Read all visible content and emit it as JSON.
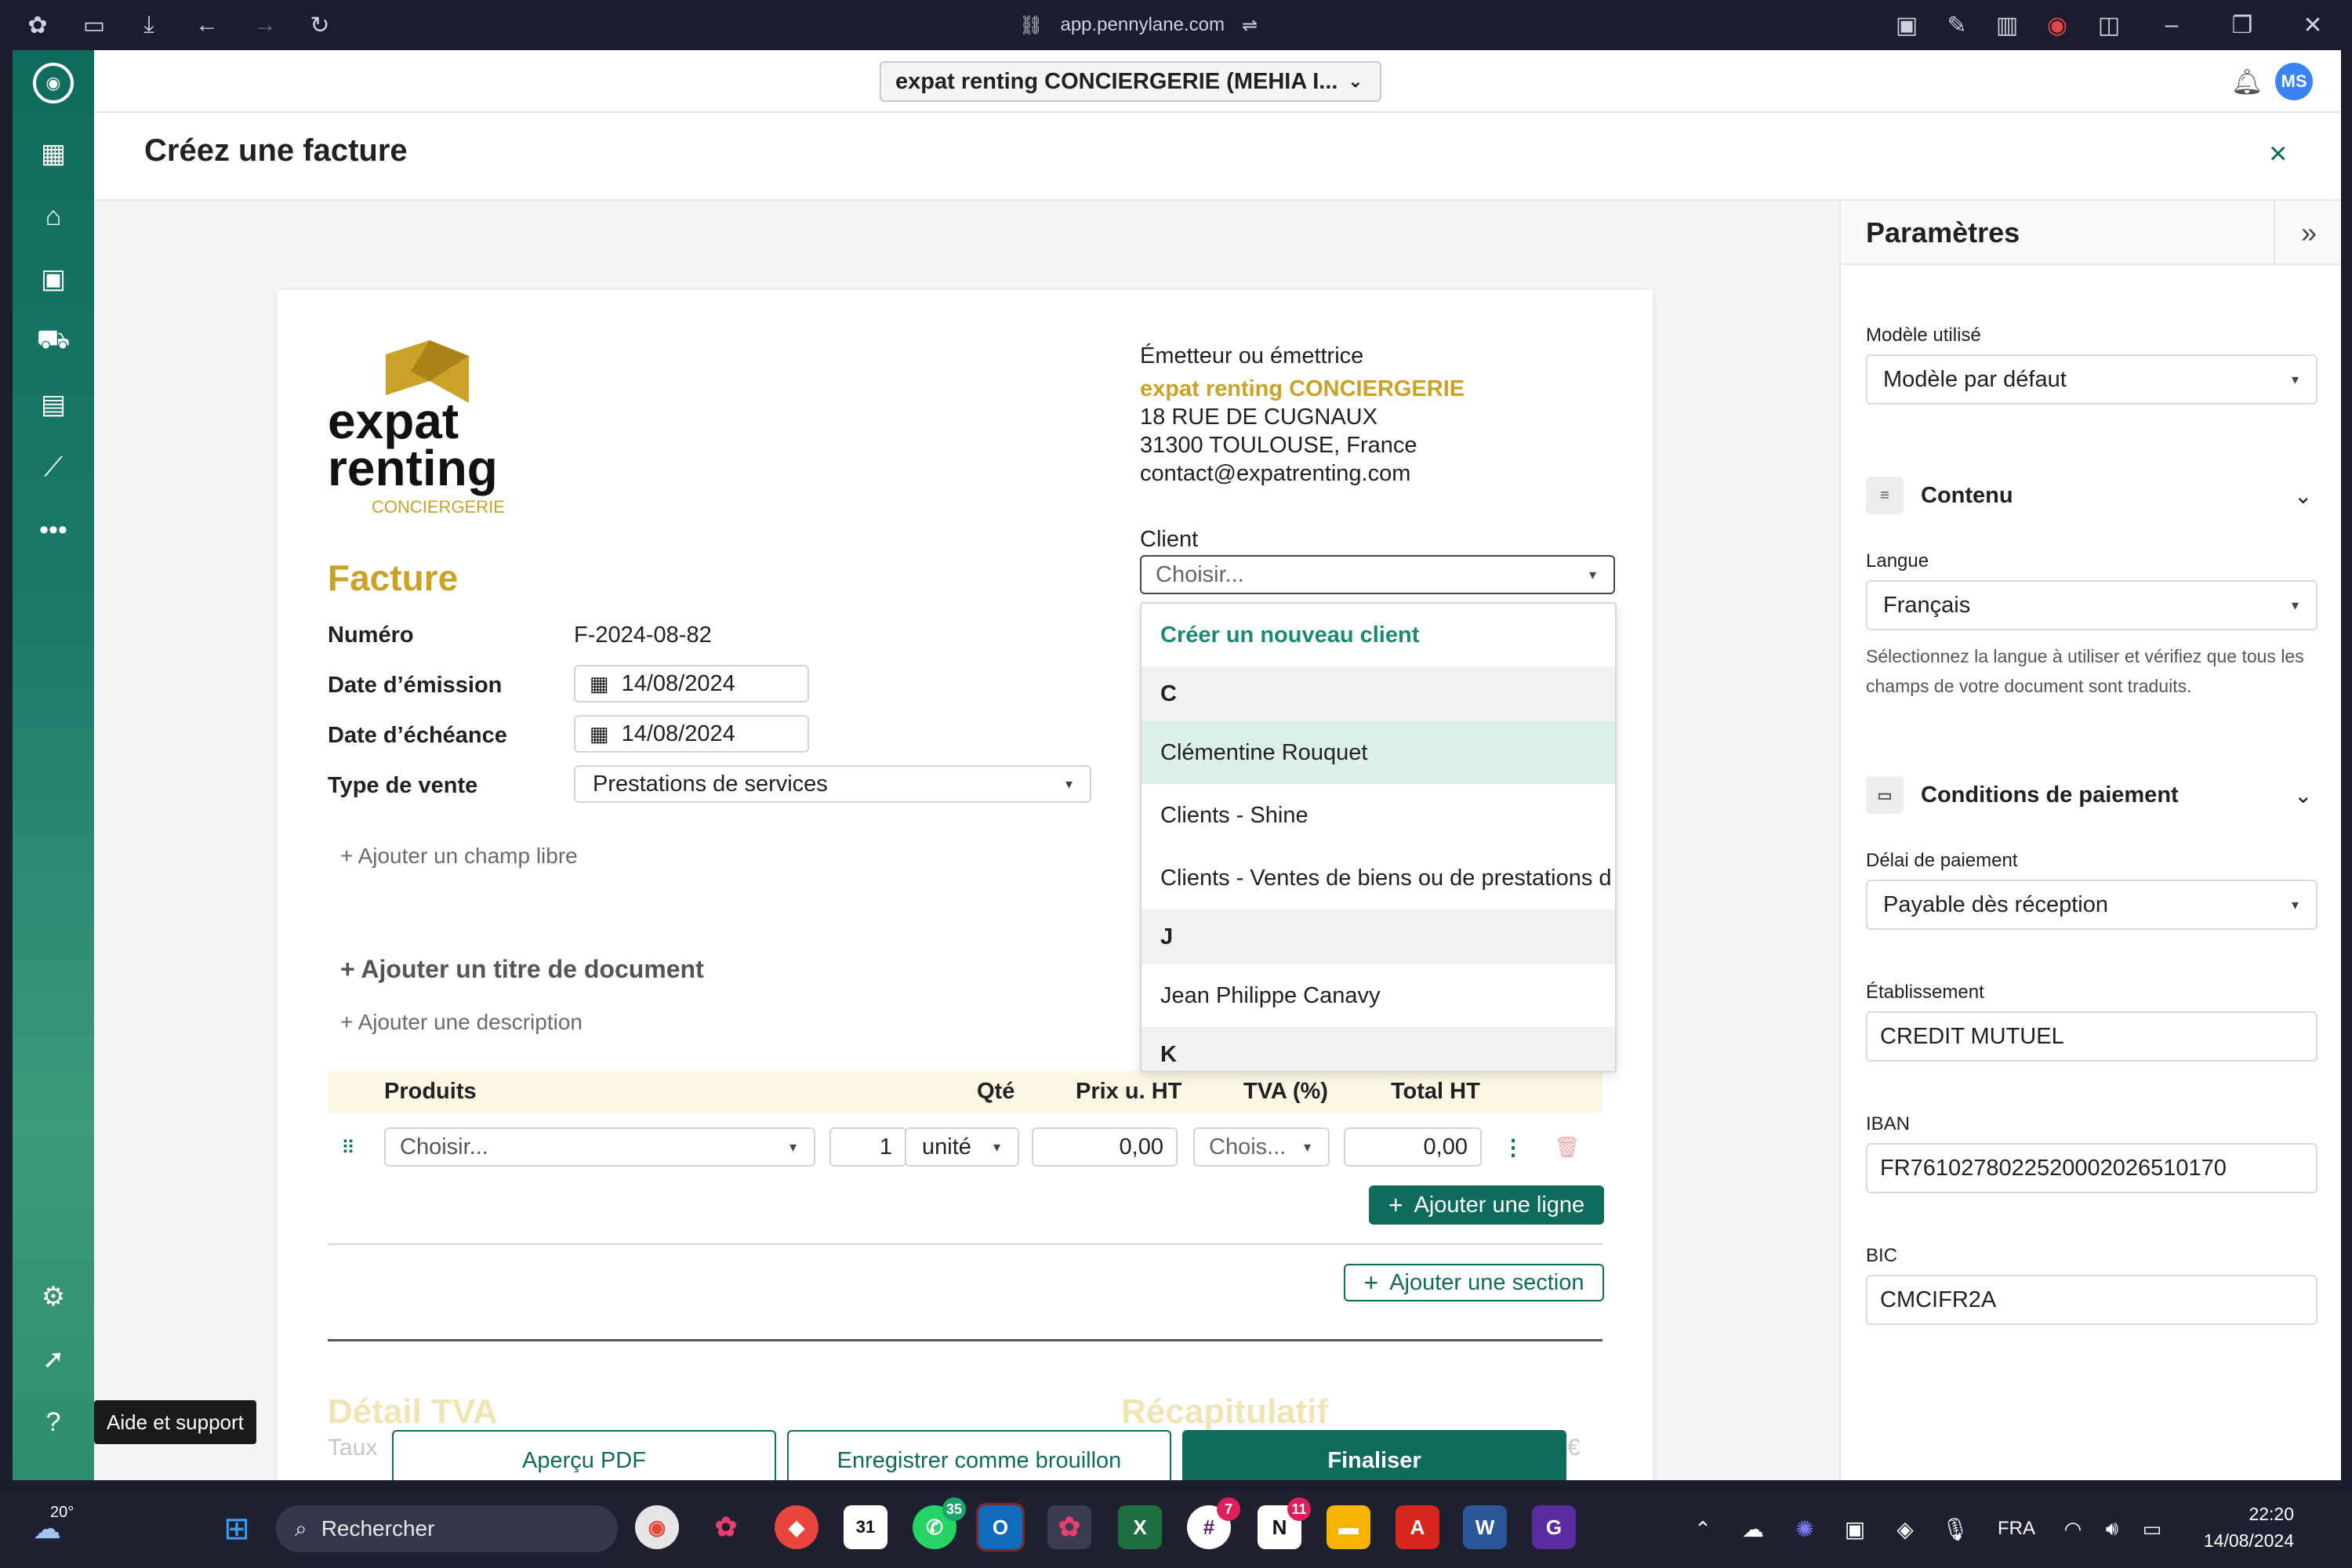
{
  "browser": {
    "url": "app.pennylane.com"
  },
  "topbar": {
    "company": "expat renting CONCIERGERIE (MEHIA I...",
    "avatar": "MS"
  },
  "header": {
    "title": "Créez une facture",
    "close": "×"
  },
  "logo": {
    "line1": "expat",
    "line2": "renting",
    "line3": "CONCIERGERIE"
  },
  "issuer": {
    "heading": "Émetteur ou émettrice",
    "name": "expat renting CONCIERGERIE",
    "street": "18 RUE DE CUGNAUX",
    "city": "31300 TOULOUSE, France",
    "email": "contact@expatrenting.com"
  },
  "client": {
    "label": "Client",
    "placeholder": "Choisir...",
    "dropdown": {
      "create": "Créer un nouveau client",
      "group_c": "C",
      "item1": "Clémentine Rouquet",
      "item2": "Clients - Shine",
      "item3": "Clients - Ventes de biens ou de prestations d",
      "group_j": "J",
      "item4": "Jean Philippe Canavy",
      "group_k": "K"
    }
  },
  "invoice": {
    "title": "Facture",
    "number_label": "Numéro",
    "number_value": "F-2024-08-82",
    "issue_label": "Date d’émission",
    "issue_value": "14/08/2024",
    "due_label": "Date d’échéance",
    "due_value": "14/08/2024",
    "type_label": "Type de vente",
    "type_value": "Prestations de services",
    "add_field": "+ Ajouter un champ libre",
    "add_title": "+ Ajouter un titre de document",
    "add_desc": "+ Ajouter une description"
  },
  "products": {
    "col_product": "Produits",
    "col_qty": "Qté",
    "col_price": "Prix u. HT",
    "col_vat": "TVA (%)",
    "col_total": "Total HT",
    "row_product": "Choisir...",
    "row_qty": "1",
    "row_unit": "unité",
    "row_price": "0,00",
    "row_vat": "Chois...",
    "row_total": "0,00",
    "add_line": "Ajouter une ligne",
    "add_section": "Ajouter une section"
  },
  "footer_partial": {
    "vat_detail": "Détail TVA",
    "rate": "Taux",
    "summary": "Récapitulatif",
    "amount": "0 €"
  },
  "actions": {
    "preview": "Aperçu PDF",
    "draft": "Enregistrer comme brouillon",
    "finalize": "Finaliser"
  },
  "tooltip": "Aide et support",
  "params": {
    "title": "Paramètres",
    "model_label": "Modèle utilisé",
    "model_value": "Modèle par défaut",
    "content_section": "Contenu",
    "lang_label": "Langue",
    "lang_value": "Français",
    "lang_help": "Sélectionnez la langue à utiliser et vérifiez que tous les champs de votre document sont traduits.",
    "payment_section": "Conditions de paiement",
    "delay_label": "Délai de paiement",
    "delay_value": "Payable dès réception",
    "bank_label": "Établissement",
    "bank_value": "CREDIT MUTUEL",
    "iban_label": "IBAN",
    "iban_value": "FR7610278022520002026510170",
    "bic_label": "BIC",
    "bic_value": "CMCIFR2A"
  },
  "taskbar": {
    "weather": "20°",
    "search": "Rechercher",
    "badge_whatsapp": "35",
    "badge_slack": "7",
    "badge_notion": "11",
    "lang": "FRA",
    "time": "22:20",
    "date": "14/08/2024"
  },
  "colors": {
    "brand_green": "#0f6b5c",
    "brand_gold": "#c9a227",
    "highlight": "#dcefe9"
  }
}
